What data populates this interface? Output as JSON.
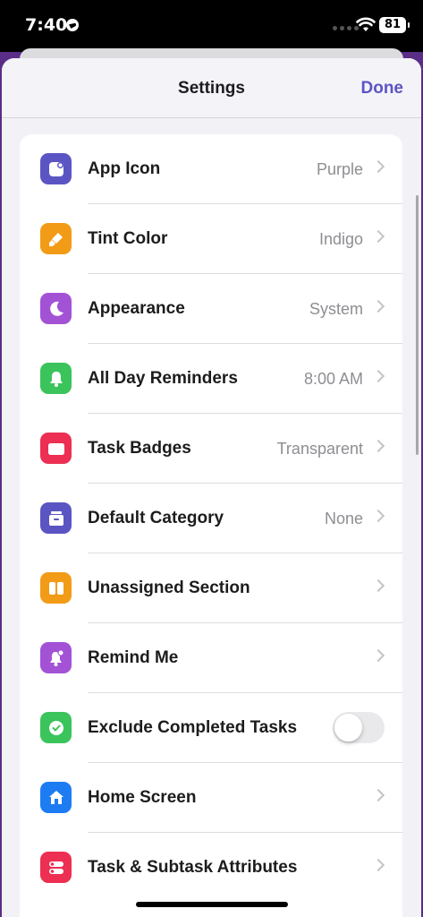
{
  "status_bar": {
    "time": "7:40",
    "battery": "81"
  },
  "nav": {
    "title": "Settings",
    "done_label": "Done"
  },
  "settings": [
    {
      "label": "App Icon",
      "value": "Purple",
      "icon": "app-icon",
      "color": "#5b55c4"
    },
    {
      "label": "Tint Color",
      "value": "Indigo",
      "icon": "paintbrush-icon",
      "color": "#f29b16"
    },
    {
      "label": "Appearance",
      "value": "System",
      "icon": "moon-icon",
      "color": "#a352d6"
    },
    {
      "label": "All Day Reminders",
      "value": "8:00 AM",
      "icon": "bell-icon",
      "color": "#3ac45b"
    },
    {
      "label": "Task Badges",
      "value": "Transparent",
      "icon": "badge-icon",
      "color": "#ec2f52"
    },
    {
      "label": "Default Category",
      "value": "None",
      "icon": "tray-icon",
      "color": "#5b55c4"
    },
    {
      "label": "Unassigned Section",
      "value": "",
      "icon": "columns-icon",
      "color": "#f29b16"
    },
    {
      "label": "Remind Me",
      "value": "",
      "icon": "bell-badge-icon",
      "color": "#a352d6"
    },
    {
      "label": "Exclude Completed Tasks",
      "value": "",
      "icon": "checkmark-circle-icon",
      "color": "#3ac45b",
      "toggle": "off"
    },
    {
      "label": "Home Screen",
      "value": "",
      "icon": "house-icon",
      "color": "#1d7cf2"
    },
    {
      "label": "Task & Subtask Attributes",
      "value": "",
      "icon": "toggles-icon",
      "color": "#ec2f52"
    }
  ]
}
